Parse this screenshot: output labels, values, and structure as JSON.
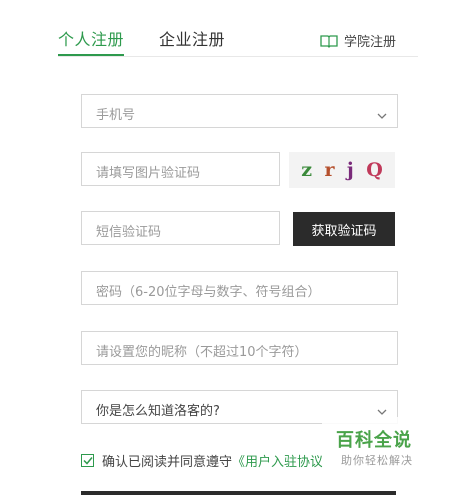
{
  "tabs": {
    "personal": "个人注册",
    "enterprise": "企业注册",
    "college": "学院注册"
  },
  "fields": {
    "phone_placeholder": "手机号",
    "image_code_placeholder": "请填写图片验证码",
    "sms_code_placeholder": "短信验证码",
    "password_placeholder": "密码（6-20位字母与数字、符号组合）",
    "nickname_placeholder": "请设置您的昵称（不超过10个字符）",
    "source_value": "你是怎么知道洛客的?"
  },
  "captcha": {
    "chars": [
      {
        "ch": "z",
        "color": "#3a8a3a"
      },
      {
        "ch": "r",
        "color": "#b5502d"
      },
      {
        "ch": "j",
        "color": "#7a2a7a"
      },
      {
        "ch": "Q",
        "color": "#c0395a"
      }
    ]
  },
  "sms_button": "获取验证码",
  "agreement": {
    "text": "确认已阅读并同意遵守",
    "link": "《用户入驻协议"
  },
  "watermark": {
    "title": "百科全说",
    "subtitle": "助你轻松解决"
  },
  "colors": {
    "accent": "#2e9a4d",
    "dark_button": "#2b2b2b"
  }
}
